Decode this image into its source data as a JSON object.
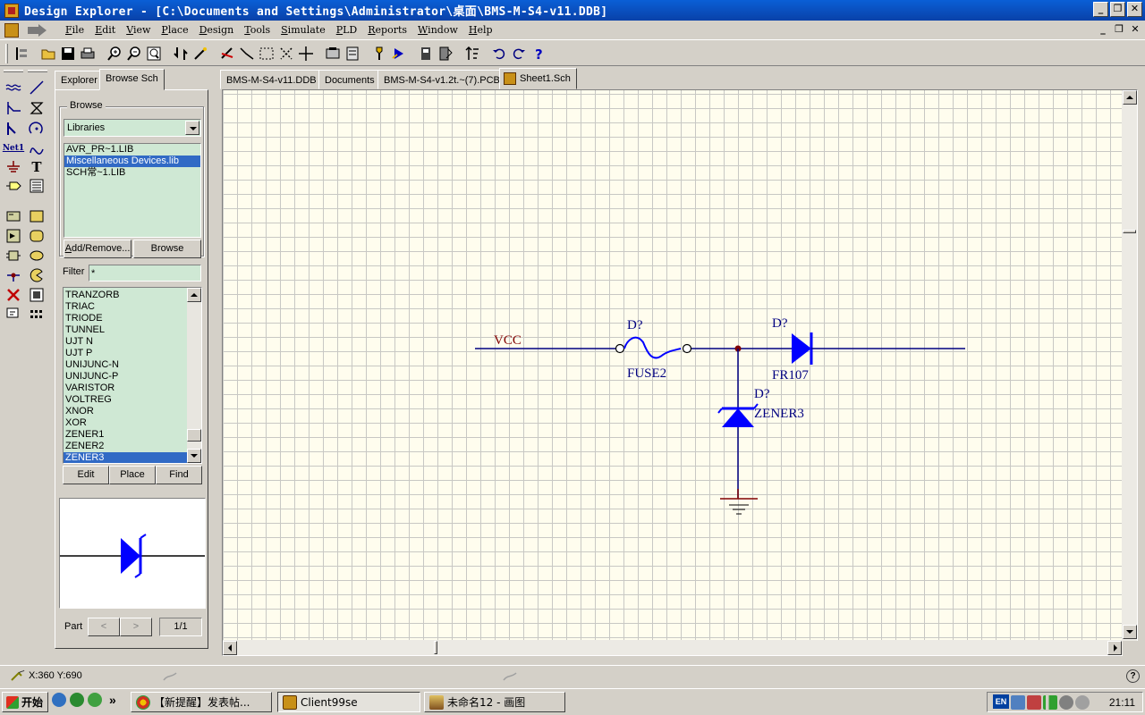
{
  "window": {
    "title": "Design Explorer - [C:\\Documents and Settings\\Administrator\\桌面\\BMS-M-S4-v11.DDB]",
    "controls": {
      "minimize": "_",
      "restore": "❐",
      "close": "✕"
    }
  },
  "menubar": {
    "items": [
      {
        "key": "F",
        "rest": "ile"
      },
      {
        "key": "E",
        "rest": "dit"
      },
      {
        "key": "V",
        "rest": "iew"
      },
      {
        "key": "P",
        "rest": "lace"
      },
      {
        "key": "D",
        "rest": "esign"
      },
      {
        "key": "T",
        "rest": "ools"
      },
      {
        "key": "S",
        "rest": "imulate"
      },
      {
        "key": "P",
        "rest": "LD"
      },
      {
        "key": "R",
        "rest": "eports"
      },
      {
        "key": "W",
        "rest": "indow"
      },
      {
        "key": "H",
        "rest": "elp"
      }
    ]
  },
  "panel": {
    "tabs": [
      "Explorer",
      "Browse Sch"
    ],
    "browse_group_label": "Browse",
    "browse_combo_value": "Libraries",
    "libraries": [
      "AVR_PR~1.LIB",
      "Miscellaneous Devices.lib",
      "SCH常~1.LIB"
    ],
    "selected_library_index": 1,
    "add_remove_label": "Add/Remove...",
    "browse_label": "Browse",
    "filter_label": "Filter",
    "filter_value": "*",
    "components": [
      "TRANZORB",
      "TRIAC",
      "TRIODE",
      "TUNNEL",
      "UJT N",
      "UJT P",
      "UNIJUNC-N",
      "UNIJUNC-P",
      "VARISTOR",
      "VOLTREG",
      "XNOR",
      "XOR",
      "ZENER1",
      "ZENER2",
      "ZENER3"
    ],
    "selected_component_index": 14,
    "edit_label": "Edit",
    "place_label": "Place",
    "find_label": "Find",
    "part_label": "Part",
    "part_prev": "<",
    "part_next": ">",
    "part_count": "1/1"
  },
  "doc_tabs": [
    "BMS-M-S4-v11.DDB",
    "Documents",
    "BMS-M-S4-v1.2t.~(7).PCB",
    "Sheet1.Sch"
  ],
  "active_doc_tab": 3,
  "schematic": {
    "net_label": "VCC",
    "fuse_designator": "D?",
    "fuse_part": "FUSE2",
    "diode_designator": "D?",
    "diode_part": "FR107",
    "zener_designator": "D?",
    "zener_part": "ZENER3",
    "wire_color": "#000080",
    "component_color": "#0000ff",
    "label_color": "#800000"
  },
  "statusbar": {
    "coords": "X:360 Y:690"
  },
  "taskbar": {
    "start_label": "开始",
    "chevron": "»",
    "tasks": [
      "【新提醒】发表帖...",
      "Client99se",
      "未命名12 - 画图"
    ],
    "active_task_index": 1,
    "ime": "EN",
    "clock": "21:11"
  }
}
